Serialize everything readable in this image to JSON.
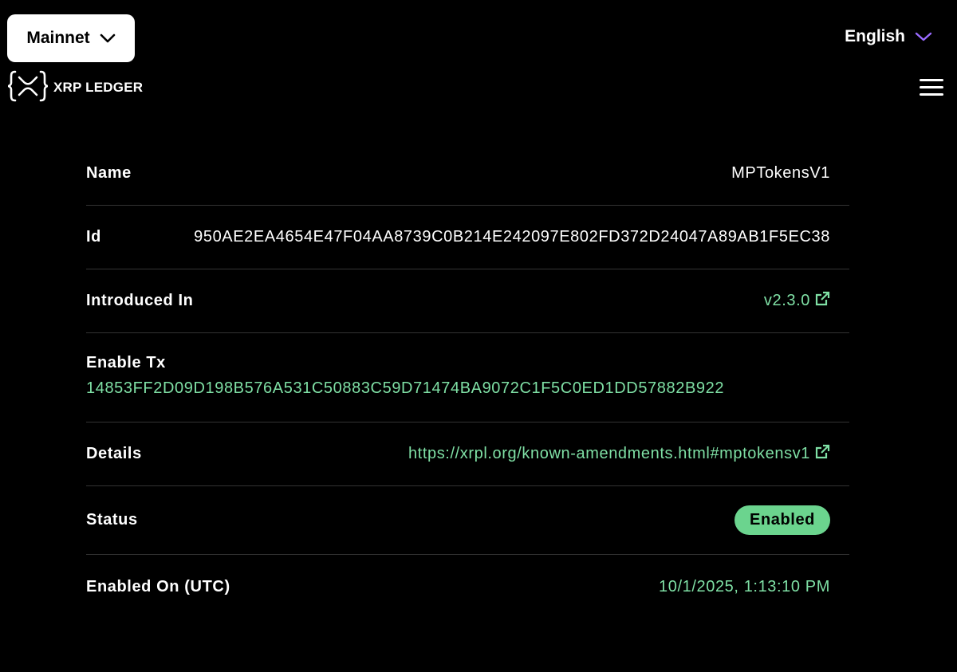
{
  "header": {
    "network": "Mainnet",
    "logo_text": "XRP LEDGER",
    "language": "English"
  },
  "colors": {
    "background": "#000000",
    "link_green": "#7fe0a5",
    "badge_green": "#6bd48e",
    "chevron_purple": "#9a6bff"
  },
  "amendment": {
    "name_label": "Name",
    "name": "MPTokensV1",
    "id_label": "Id",
    "id": "950AE2EA4654E47F04AA8739C0B214E242097E802FD372D24047A89AB1F5EC38",
    "introduced_label": "Introduced In",
    "introduced": "v2.3.0",
    "enable_tx_label": "Enable Tx",
    "enable_tx": "14853FF2D09D198B576A531C50883C59D71474BA9072C1F5C0ED1DD57882B922",
    "details_label": "Details",
    "details": "https://xrpl.org/known-amendments.html#mptokensv1",
    "status_label": "Status",
    "status": "Enabled",
    "enabled_on_label": "Enabled On (UTC)",
    "enabled_on": "10/1/2025, 1:13:10 PM"
  },
  "icons": [
    "chevron-down-icon",
    "xrpl-logo-icon",
    "menu-icon",
    "external-link-icon"
  ]
}
